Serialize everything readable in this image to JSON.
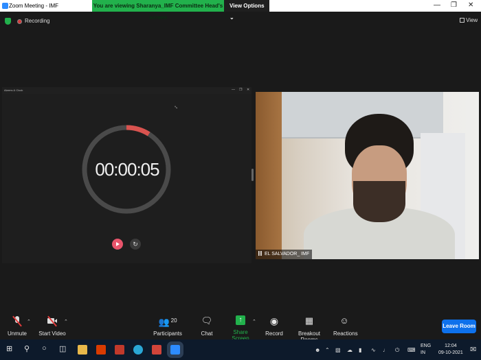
{
  "window": {
    "title": "Zoom Meeting - IMF",
    "banner_text": "You are viewing Sharanya_IMF Committee Head's screen",
    "view_options_label": "View Options ⌄",
    "controls": [
      "—",
      "❐",
      "✕"
    ]
  },
  "topbar": {
    "recording_label": "Recording",
    "view_label": "View"
  },
  "shared_screen": {
    "app_title": "Alarms & Clock",
    "window_controls": [
      "—",
      "❐",
      "✕"
    ],
    "timer_value": "00:00:05",
    "progress_fraction": 0.09,
    "progress_color": "#d9534f"
  },
  "video": {
    "participant_name": "EL SALVADOR_ IMF"
  },
  "toolbar": {
    "unmute_label": "Unmute",
    "start_video_label": "Start Video",
    "participants_label": "Participants",
    "participants_count": "20",
    "chat_label": "Chat",
    "share_screen_label": "Share Screen",
    "record_label": "Record",
    "breakout_label": "Breakout Rooms",
    "reactions_label": "Reactions",
    "leave_label": "Leave Room"
  },
  "taskbar": {
    "language_line1": "ENG",
    "language_line2": "IN",
    "time": "12:04",
    "date": "09-10-2021"
  },
  "colors": {
    "accent_green": "#22b14c",
    "leave_blue": "#0e71eb",
    "mute_red": "#e23c3c"
  }
}
